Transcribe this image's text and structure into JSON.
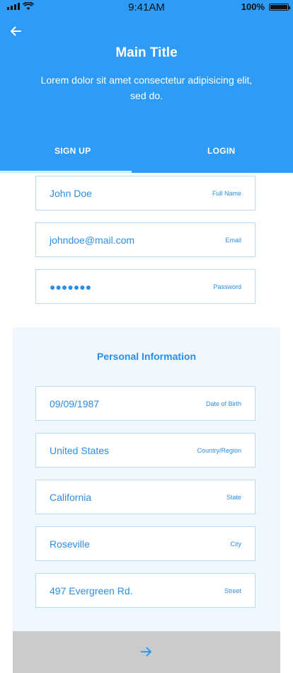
{
  "status": {
    "time": "9:41AM",
    "battery": "100%"
  },
  "header": {
    "title": "Main Title",
    "subtitle": "Lorem dolor sit amet consectetur adipisicing elit, sed do."
  },
  "tabs": {
    "signup": "SIGN UP",
    "login": "LOGIN"
  },
  "account_fields": [
    {
      "value": "John Doe",
      "label": "Full Name"
    },
    {
      "value": "johndoe@mail.com",
      "label": "Email"
    },
    {
      "value": "●●●●●●●",
      "label": "Password"
    }
  ],
  "personal": {
    "title": "Personal Information",
    "fields": [
      {
        "value": "09/09/1987",
        "label": "Date of Birth"
      },
      {
        "value": "United States",
        "label": "Country/Region"
      },
      {
        "value": "California",
        "label": "State"
      },
      {
        "value": "Roseville",
        "label": "City"
      },
      {
        "value": "497 Evergreen Rd.",
        "label": "Street"
      }
    ]
  },
  "icons": {
    "back": "arrow-left-icon",
    "submit": "arrow-right-icon",
    "signal": "signal-icon",
    "wifi": "wifi-icon",
    "battery": "battery-icon"
  },
  "colors": {
    "primary": "#2e9bf7",
    "field_text": "#2a8ee6",
    "field_border": "#b9dbf2",
    "panel_bg": "#f0f7ff",
    "submit_bg": "#cbcbcb"
  }
}
